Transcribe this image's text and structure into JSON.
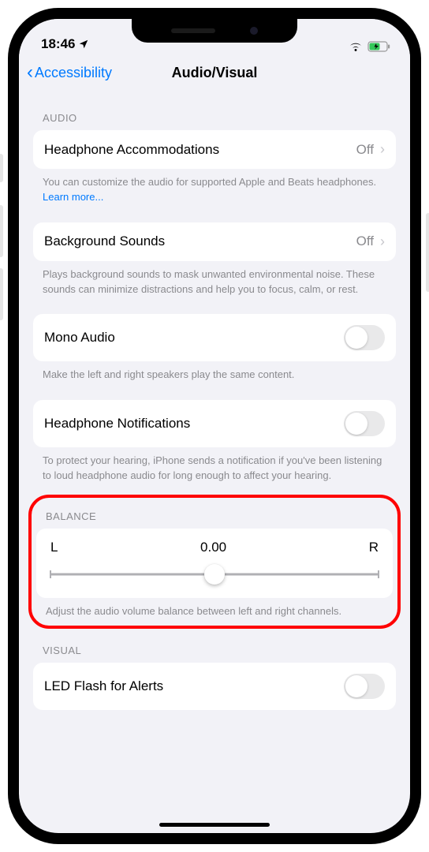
{
  "statusbar": {
    "time": "18:46"
  },
  "nav": {
    "back": "Accessibility",
    "title": "Audio/Visual"
  },
  "sections": {
    "audio_header": "AUDIO",
    "headphone_accom": {
      "label": "Headphone Accommodations",
      "value": "Off"
    },
    "headphone_accom_footer_a": "You can customize the audio for supported Apple and Beats headphones. ",
    "headphone_accom_footer_link": "Learn more...",
    "background_sounds": {
      "label": "Background Sounds",
      "value": "Off"
    },
    "background_sounds_footer": "Plays background sounds to mask unwanted environmental noise. These sounds can minimize distractions and help you to focus, calm, or rest.",
    "mono_audio": {
      "label": "Mono Audio"
    },
    "mono_audio_footer": "Make the left and right speakers play the same content.",
    "headphone_notif": {
      "label": "Headphone Notifications"
    },
    "headphone_notif_footer": "To protect your hearing, iPhone sends a notification if you've been listening to loud headphone audio for long enough to affect your hearing.",
    "balance_header": "BALANCE",
    "balance": {
      "left": "L",
      "value": "0.00",
      "right": "R"
    },
    "balance_footer": "Adjust the audio volume balance between left and right channels.",
    "visual_header": "VISUAL",
    "led_flash": {
      "label": "LED Flash for Alerts"
    }
  }
}
